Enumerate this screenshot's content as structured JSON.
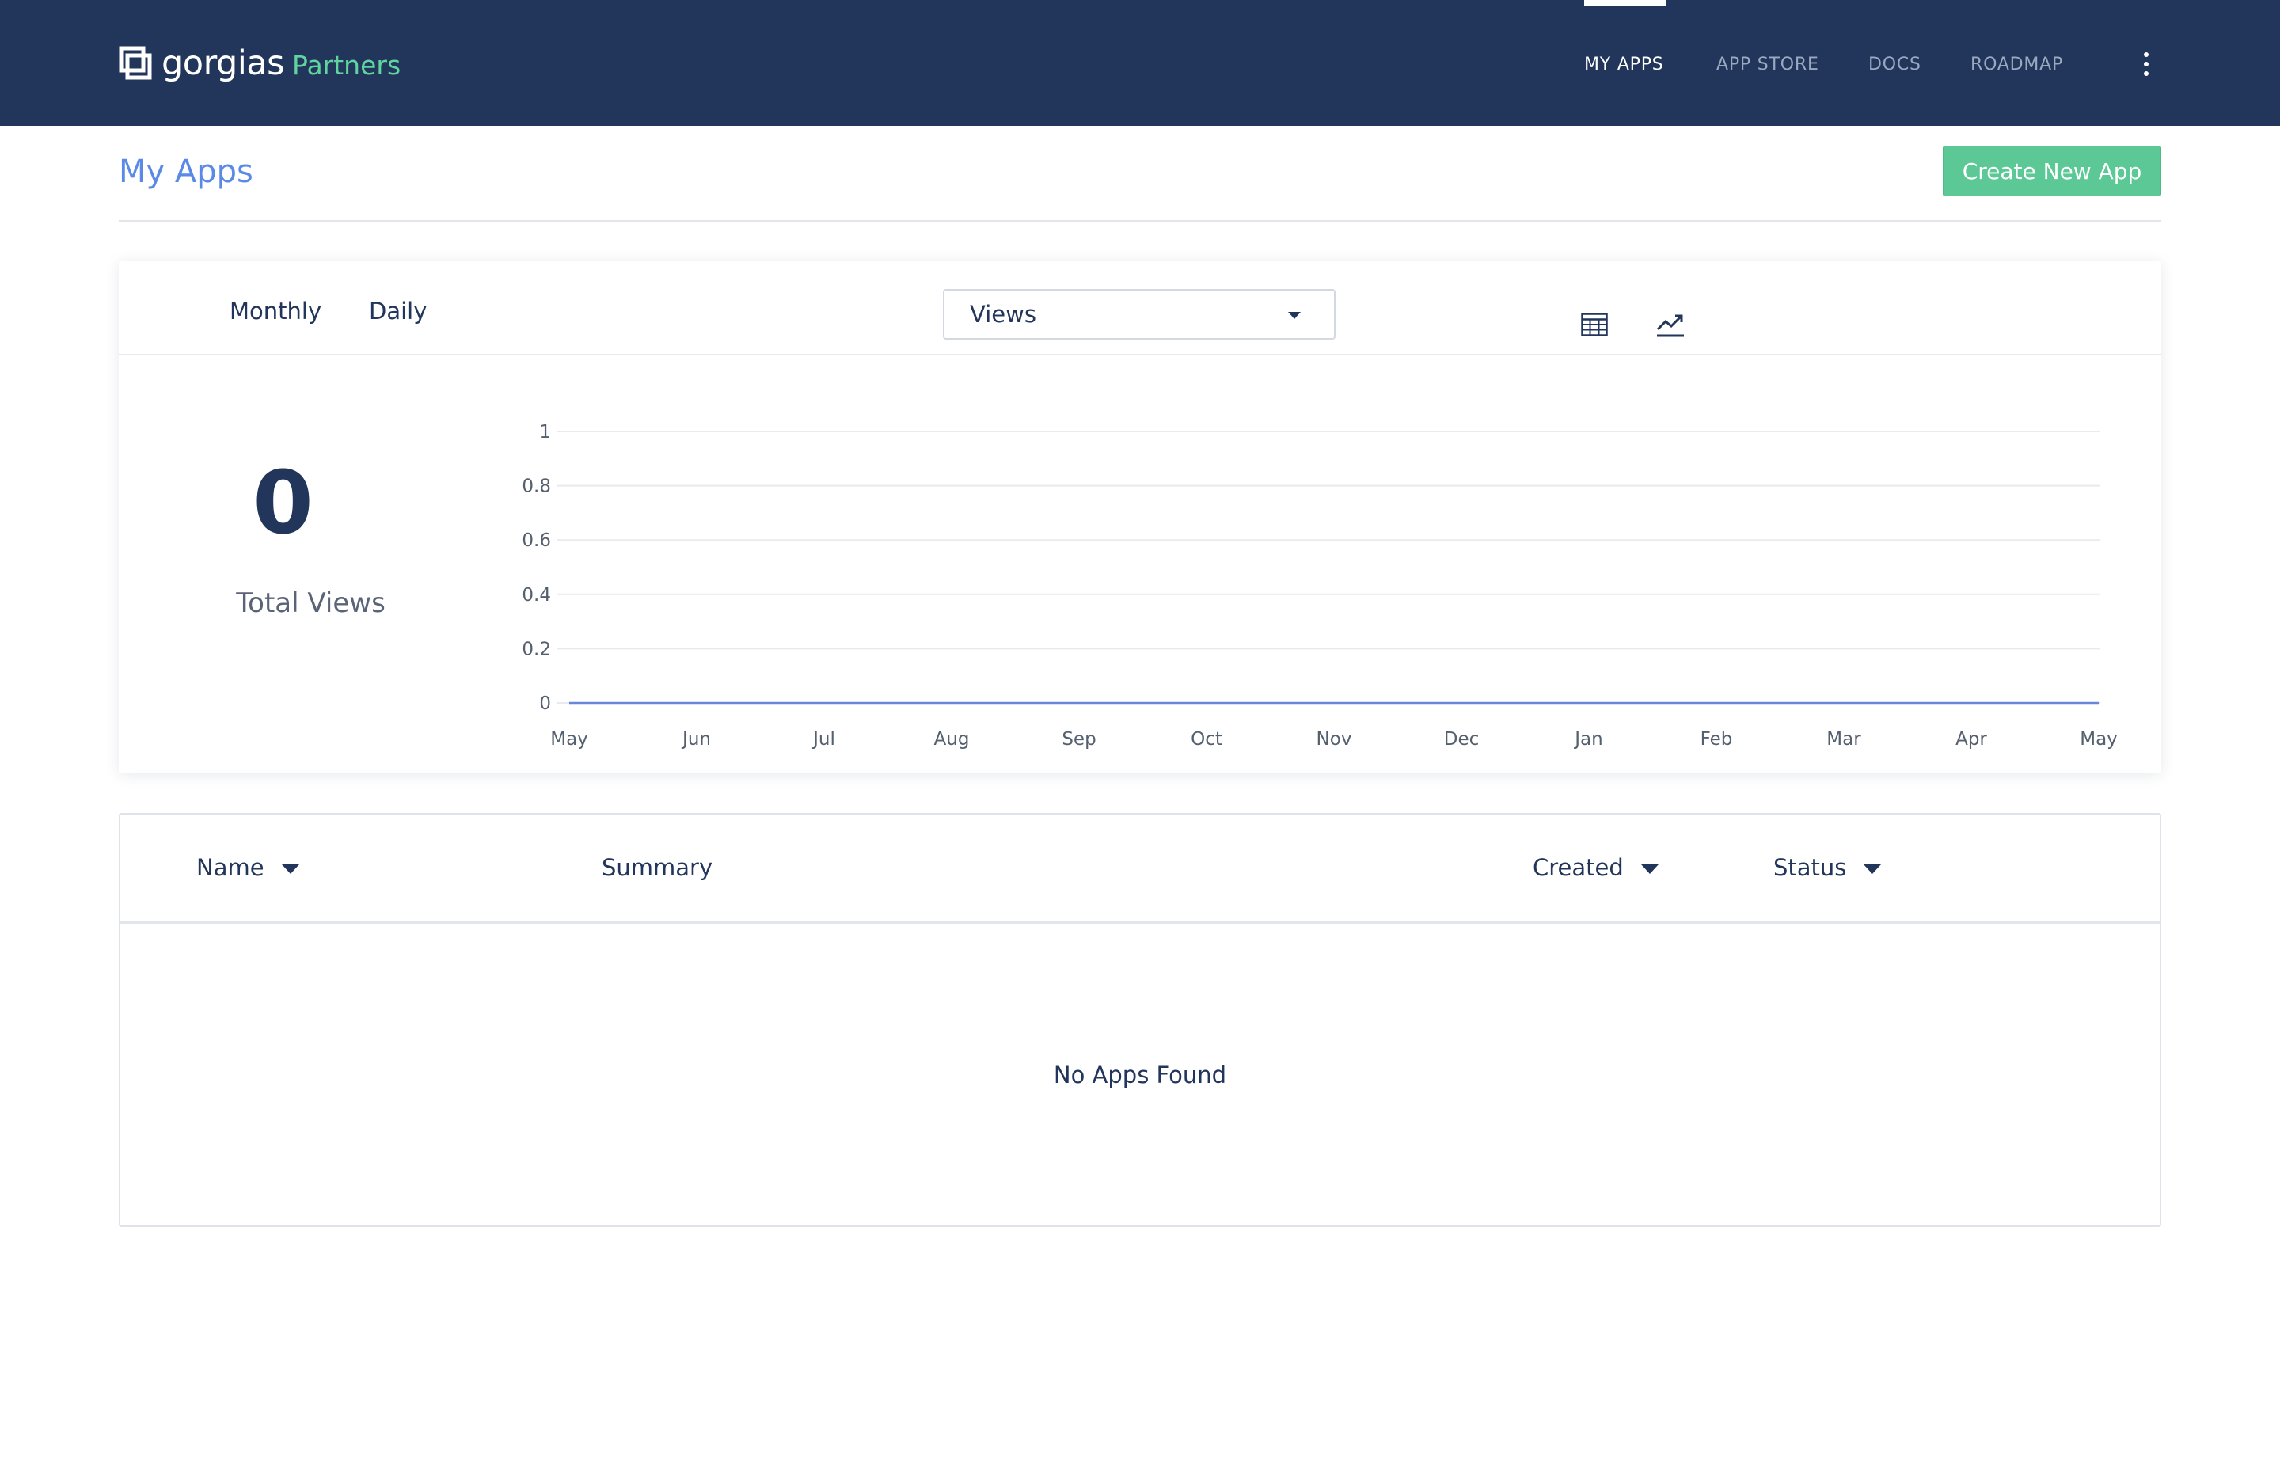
{
  "brand": {
    "name": "gorgias",
    "suffix": "Partners",
    "logo_icon": "gorgias-logo-icon"
  },
  "nav": {
    "items": [
      {
        "label": "MY APPS",
        "active": true
      },
      {
        "label": "APP STORE",
        "active": false
      },
      {
        "label": "DOCS",
        "active": false
      },
      {
        "label": "ROADMAP",
        "active": false
      }
    ],
    "more_icon": "kebab-menu-icon"
  },
  "page": {
    "title": "My Apps",
    "create_button": "Create New App"
  },
  "stats": {
    "tabs": [
      "Monthly",
      "Daily"
    ],
    "view_icons": [
      "table-icon",
      "line-chart-icon"
    ],
    "metric_select": "Views",
    "total_value": "0",
    "total_label": "Total Views"
  },
  "chart_data": {
    "type": "line",
    "categories": [
      "May",
      "Jun",
      "Jul",
      "Aug",
      "Sep",
      "Oct",
      "Nov",
      "Dec",
      "Jan",
      "Feb",
      "Mar",
      "Apr",
      "May"
    ],
    "series": [
      {
        "values": [
          0,
          0,
          0,
          0,
          0,
          0,
          0,
          0,
          0,
          0,
          0,
          0,
          0
        ],
        "color": "#6a86d8"
      }
    ],
    "yticks": [
      "1",
      "0.8",
      "0.6",
      "0.4",
      "0.2",
      "0"
    ],
    "ylim": [
      0,
      1
    ],
    "grid": true,
    "title": "",
    "xlabel": "",
    "ylabel": ""
  },
  "table": {
    "columns": [
      {
        "label": "Name",
        "sortable": true
      },
      {
        "label": "Summary",
        "sortable": false
      },
      {
        "label": "Created",
        "sortable": true
      },
      {
        "label": "Status",
        "sortable": true
      }
    ],
    "rows": [],
    "empty_message": "No Apps Found"
  },
  "colors": {
    "nav_bg": "#22355a",
    "accent_green": "#5cc896",
    "title_blue": "#5b8ae6",
    "text_dark": "#22355a"
  }
}
